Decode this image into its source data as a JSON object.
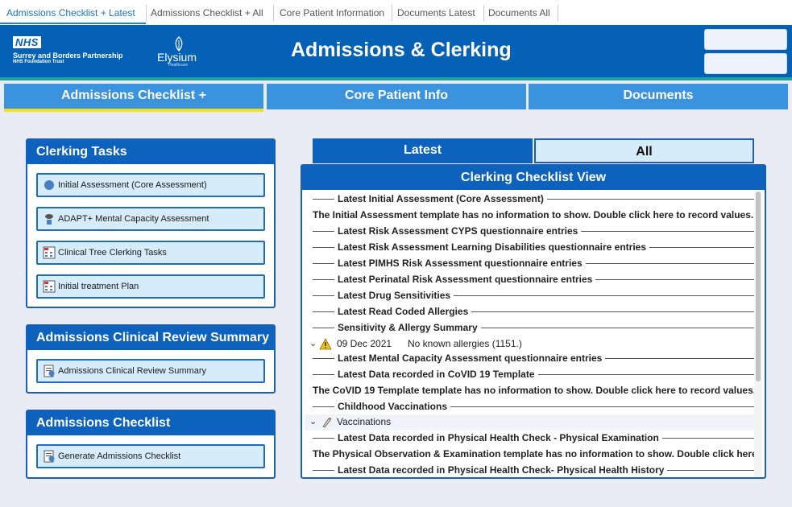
{
  "top_tabs": [
    {
      "label": "Admissions Checklist + Latest",
      "active": true
    },
    {
      "label": "Admissions Checklist + All"
    },
    {
      "label": "Core Patient Information"
    },
    {
      "label": "Documents Latest"
    },
    {
      "label": "Documents All"
    }
  ],
  "header": {
    "nhs": "NHS",
    "org_name": "Surrey and Borders Partnership",
    "org_sub": "NHS Foundation Trust",
    "partner": "Elysium",
    "partner_sub": "Healthcare",
    "title": "Admissions & Clerking"
  },
  "nav": {
    "items": [
      "Admissions Checklist +",
      "Core Patient Info",
      "Documents"
    ],
    "active_index": 0
  },
  "panels": {
    "clerking": {
      "title": "Clerking Tasks",
      "items": [
        {
          "label": "Initial Assessment (Core Assessment)",
          "icon": "circle-icon"
        },
        {
          "label": "ADAPT+ Mental Capacity Assessment",
          "icon": "person-icon"
        },
        {
          "label": "Clinical Tree Clerking Tasks",
          "icon": "form-icon"
        },
        {
          "label": "Initial treatment Plan",
          "icon": "form-icon"
        }
      ]
    },
    "review": {
      "title": "Admissions Clinical Review Summary",
      "items": [
        {
          "label": "Admissions Clinical Review Summary",
          "icon": "document-icon"
        }
      ]
    },
    "checklist": {
      "title": "Admissions Checklist",
      "items": [
        {
          "label": "Generate Admissions Checklist",
          "icon": "document-icon"
        }
      ]
    }
  },
  "view_tabs": {
    "latest": "Latest",
    "all": "All",
    "active": "latest"
  },
  "checklist_view": {
    "title": "Clerking Checklist View",
    "rows": [
      {
        "type": "section",
        "text": "Latest Initial Assessment (Core Assessment)"
      },
      {
        "type": "message",
        "text": "The Initial Assessment template has no information to show. Double click here to record values."
      },
      {
        "type": "section",
        "text": "Latest Risk Assessment CYPS questionnaire entries"
      },
      {
        "type": "section",
        "text": "Latest Risk Assessment Learning Disabilities questionnaire entries"
      },
      {
        "type": "section",
        "text": "Latest PIMHS Risk Assessment questionnaire entries"
      },
      {
        "type": "section",
        "text": "Latest Perinatal Risk Assessment questionnaire entries"
      },
      {
        "type": "section",
        "text": "Latest Drug Sensitivities"
      },
      {
        "type": "section",
        "text": "Latest Read Coded Allergies"
      },
      {
        "type": "section",
        "text": "Sensitivity & Allergy Summary"
      },
      {
        "type": "item",
        "date": "09 Dec 2021",
        "text": "No known allergies (1151.)",
        "icon": "warning-icon"
      },
      {
        "type": "section",
        "text": "Latest Mental Capacity Assessment questionnaire entries"
      },
      {
        "type": "section",
        "text": "Latest Data recorded in CoVID 19 Template"
      },
      {
        "type": "message",
        "text": "The CoVID 19 Template template has no information to show. Double click here to record values."
      },
      {
        "type": "section",
        "text": "Childhood Vaccinations"
      },
      {
        "type": "item",
        "text": "Vaccinations",
        "icon": "syringe-icon",
        "shaded": true
      },
      {
        "type": "section",
        "text": "Latest Data recorded in Physical Health Check  - Physical Examination"
      },
      {
        "type": "message",
        "text": "The Physical Observation & Examination template has no information to show. Double click here to record values."
      },
      {
        "type": "section",
        "text": "Latest Data recorded in Physical Health Check- Physical Health History"
      }
    ]
  },
  "colors": {
    "brand": "#0561b5",
    "accent": "#f2e11a",
    "teal": "#1fa39a"
  }
}
